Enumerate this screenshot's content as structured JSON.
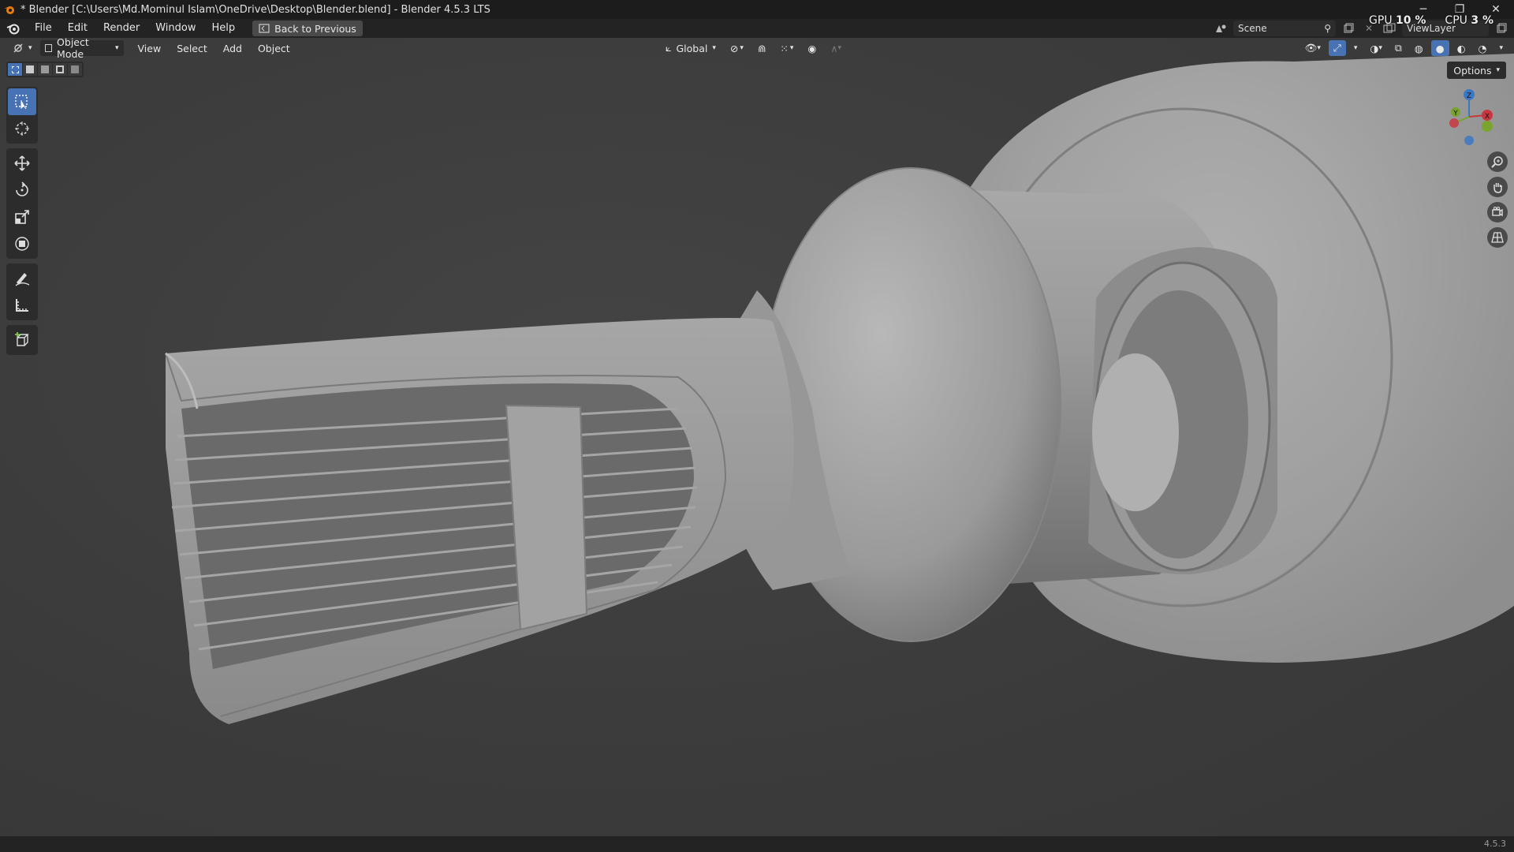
{
  "window": {
    "title": "* Blender [C:\\Users\\Md.Mominul Islam\\OneDrive\\Desktop\\Blender.blend] - Blender 4.5.3 LTS",
    "minimize": "─",
    "restore": "❐",
    "close": "✕"
  },
  "menu": {
    "file": "File",
    "edit": "Edit",
    "render": "Render",
    "window": "Window",
    "help": "Help",
    "back_to_previous": "Back to Previous"
  },
  "top_right": {
    "scene": "Scene",
    "view_layer": "ViewLayer"
  },
  "performance": {
    "gpu_label": "GPU",
    "gpu_value": "10 %",
    "cpu_label": "CPU",
    "cpu_value": "3 %"
  },
  "viewport_header": {
    "mode": "Object Mode",
    "view": "View",
    "select": "Select",
    "add": "Add",
    "object": "Object",
    "transform_orientation": "Global",
    "options": "Options"
  },
  "gizmo": {
    "z": "Z",
    "x": "X",
    "y": "Y"
  },
  "status": {
    "version": "4.5.3"
  },
  "colors": {
    "accent": "#4772b3",
    "axis_x": "#c8373f",
    "axis_y": "#7aa42d",
    "axis_z": "#3b78c4"
  }
}
